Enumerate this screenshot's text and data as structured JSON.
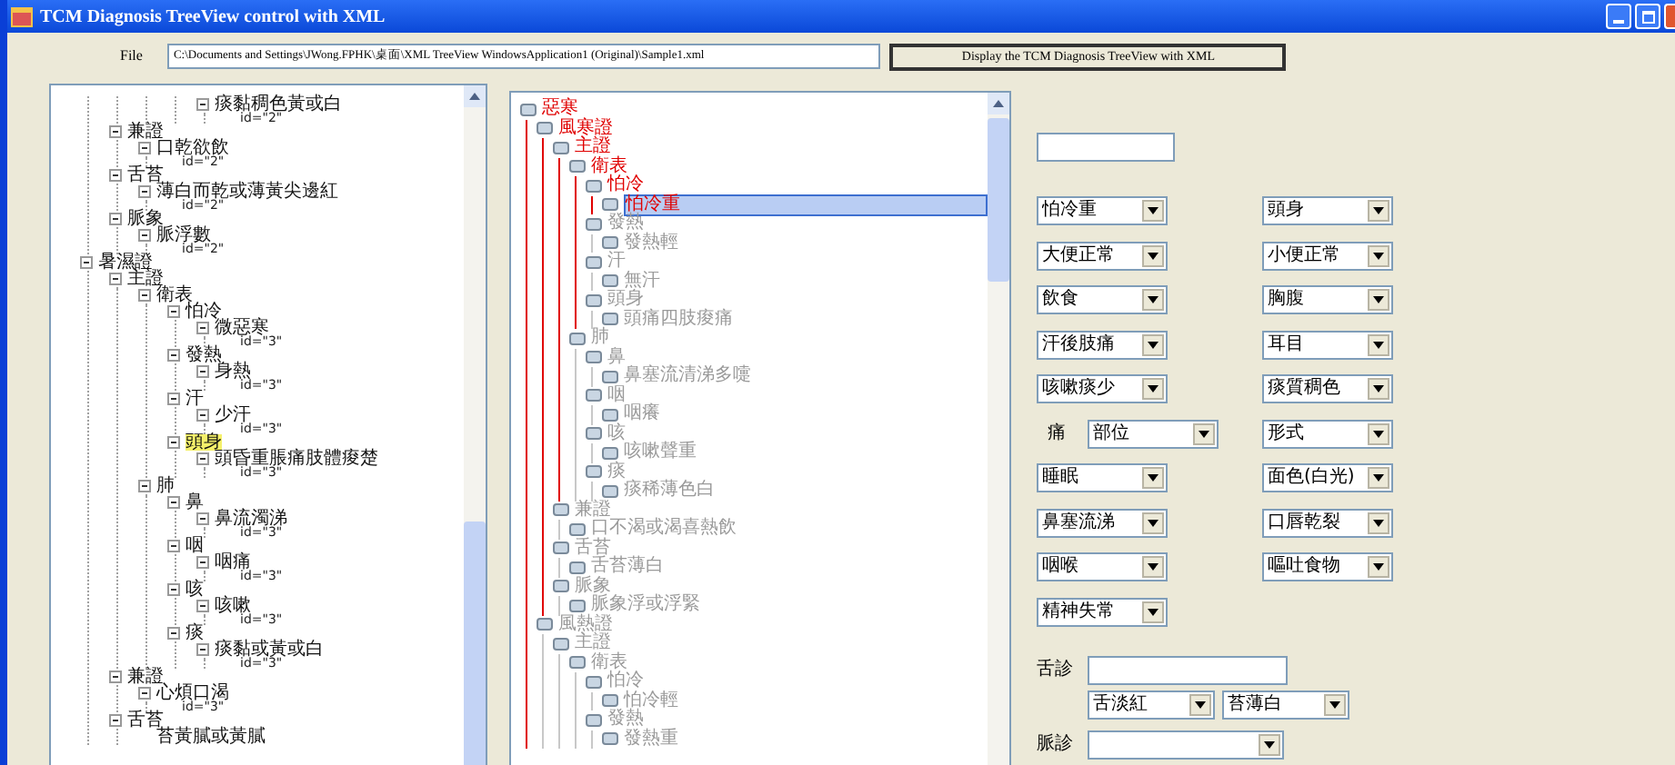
{
  "window": {
    "title": "TCM Diagnosis TreeView control with XML"
  },
  "file_row": {
    "label": "File",
    "path": "C:\\Documents and Settings\\JWong.FPHK\\桌面\\XML TreeView WindowsApplication1 (Original)\\Sample1.xml",
    "button": "Display the TCM Diagnosis TreeView with XML"
  },
  "xml_tree": {
    "nodes": [
      {
        "kind": "offscreen",
        "children": [
          {
            "kind": "offscreen",
            "children": [
              {
                "kind": "offscreen",
                "children": [
                  {
                    "kind": "offscreen",
                    "children": [
                      {
                        "kind": "node",
                        "label": "痰黏稠色黃或白",
                        "selected": false,
                        "children": [
                          {
                            "kind": "attr",
                            "label": "id=\"2\"",
                            "selected": false
                          }
                        ]
                      }
                    ]
                  }
                ]
              }
            ]
          },
          {
            "kind": "node",
            "label": "兼證",
            "selected": false,
            "children": [
              {
                "kind": "node",
                "label": "口乾欲飲",
                "selected": false,
                "children": [
                  {
                    "kind": "attr",
                    "label": "id=\"2\"",
                    "selected": false
                  }
                ]
              }
            ]
          },
          {
            "kind": "node",
            "label": "舌苔",
            "selected": false,
            "children": [
              {
                "kind": "node",
                "label": "薄白而乾或薄黃尖邊紅",
                "selected": false,
                "children": [
                  {
                    "kind": "attr",
                    "label": "id=\"2\"",
                    "selected": false
                  }
                ]
              }
            ]
          },
          {
            "kind": "node",
            "label": "脈象",
            "selected": false,
            "children": [
              {
                "kind": "node",
                "label": "脈浮數",
                "selected": false,
                "children": [
                  {
                    "kind": "attr",
                    "label": "id=\"2\"",
                    "selected": false
                  }
                ]
              }
            ]
          }
        ]
      },
      {
        "kind": "node",
        "label": "暑濕證",
        "selected": false,
        "children": [
          {
            "kind": "node",
            "label": "主證",
            "selected": false,
            "children": [
              {
                "kind": "node",
                "label": "衛表",
                "selected": false,
                "children": [
                  {
                    "kind": "node",
                    "label": "怕冷",
                    "selected": false,
                    "children": [
                      {
                        "kind": "node",
                        "label": "微惡寒",
                        "selected": false,
                        "children": [
                          {
                            "kind": "attr",
                            "label": "id=\"3\"",
                            "selected": false
                          }
                        ]
                      }
                    ]
                  },
                  {
                    "kind": "node",
                    "label": "發熱",
                    "selected": false,
                    "children": [
                      {
                        "kind": "node",
                        "label": "身熱",
                        "selected": false,
                        "children": [
                          {
                            "kind": "attr",
                            "label": "id=\"3\"",
                            "selected": false
                          }
                        ]
                      }
                    ]
                  },
                  {
                    "kind": "node",
                    "label": "汗",
                    "selected": false,
                    "children": [
                      {
                        "kind": "node",
                        "label": "少汗",
                        "selected": false,
                        "children": [
                          {
                            "kind": "attr",
                            "label": "id=\"3\"",
                            "selected": false
                          }
                        ]
                      }
                    ]
                  },
                  {
                    "kind": "node",
                    "label": "頭身",
                    "selected": true,
                    "children": [
                      {
                        "kind": "node",
                        "label": "頭昏重脹痛肢體痠楚",
                        "selected": false,
                        "children": [
                          {
                            "kind": "attr",
                            "label": "id=\"3\"",
                            "selected": false
                          }
                        ]
                      }
                    ]
                  }
                ]
              },
              {
                "kind": "node",
                "label": "肺",
                "selected": false,
                "children": [
                  {
                    "kind": "node",
                    "label": "鼻",
                    "selected": false,
                    "children": [
                      {
                        "kind": "node",
                        "label": "鼻流濁涕",
                        "selected": false,
                        "children": [
                          {
                            "kind": "attr",
                            "label": "id=\"3\"",
                            "selected": false
                          }
                        ]
                      }
                    ]
                  },
                  {
                    "kind": "node",
                    "label": "咽",
                    "selected": false,
                    "children": [
                      {
                        "kind": "node",
                        "label": "咽痛",
                        "selected": false,
                        "children": [
                          {
                            "kind": "attr",
                            "label": "id=\"3\"",
                            "selected": false
                          }
                        ]
                      }
                    ]
                  },
                  {
                    "kind": "node",
                    "label": "咳",
                    "selected": false,
                    "children": [
                      {
                        "kind": "node",
                        "label": "咳嗽",
                        "selected": false,
                        "children": [
                          {
                            "kind": "attr",
                            "label": "id=\"3\"",
                            "selected": false
                          }
                        ]
                      }
                    ]
                  },
                  {
                    "kind": "node",
                    "label": "痰",
                    "selected": false,
                    "children": [
                      {
                        "kind": "node",
                        "label": "痰黏或黃或白",
                        "selected": false,
                        "children": [
                          {
                            "kind": "attr",
                            "label": "id=\"3\"",
                            "selected": false
                          }
                        ]
                      }
                    ]
                  }
                ]
              }
            ]
          },
          {
            "kind": "node",
            "label": "兼證",
            "selected": false,
            "children": [
              {
                "kind": "node",
                "label": "心煩口渴",
                "selected": false,
                "children": [
                  {
                    "kind": "attr",
                    "label": "id=\"3\"",
                    "selected": false
                  }
                ]
              }
            ]
          },
          {
            "kind": "node",
            "label": "舌苔",
            "selected": false,
            "children": [
              {
                "kind": "node",
                "label": "苔黃膩或黃膩",
                "selected": false
              }
            ]
          }
        ]
      }
    ]
  },
  "diagnosis_tree": {
    "nodes": [
      {
        "label": "惡寒",
        "on_path": true,
        "selected": false,
        "children": [
          {
            "label": "風寒證",
            "on_path": true,
            "selected": false,
            "children": [
              {
                "label": "主證",
                "on_path": true,
                "selected": false,
                "children": [
                  {
                    "label": "衛表",
                    "on_path": true,
                    "selected": false,
                    "children": [
                      {
                        "label": "怕冷",
                        "on_path": true,
                        "selected": false,
                        "children": [
                          {
                            "label": "怕冷重",
                            "on_path": true,
                            "selected": true
                          }
                        ]
                      },
                      {
                        "label": "發熱",
                        "on_path": false,
                        "selected": false,
                        "children": [
                          {
                            "label": "發熱輕",
                            "on_path": false,
                            "selected": false
                          }
                        ]
                      },
                      {
                        "label": "汗",
                        "on_path": false,
                        "selected": false,
                        "children": [
                          {
                            "label": "無汗",
                            "on_path": false,
                            "selected": false
                          }
                        ]
                      },
                      {
                        "label": "頭身",
                        "on_path": false,
                        "selected": false,
                        "children": [
                          {
                            "label": "頭痛四肢痠痛",
                            "on_path": false,
                            "selected": false
                          }
                        ]
                      }
                    ]
                  },
                  {
                    "label": "肺",
                    "on_path": false,
                    "selected": false,
                    "children": [
                      {
                        "label": "鼻",
                        "on_path": false,
                        "selected": false,
                        "children": [
                          {
                            "label": "鼻塞流清涕多嚏",
                            "on_path": false,
                            "selected": false
                          }
                        ]
                      },
                      {
                        "label": "咽",
                        "on_path": false,
                        "selected": false,
                        "children": [
                          {
                            "label": "咽癢",
                            "on_path": false,
                            "selected": false
                          }
                        ]
                      },
                      {
                        "label": "咳",
                        "on_path": false,
                        "selected": false,
                        "children": [
                          {
                            "label": "咳嗽聲重",
                            "on_path": false,
                            "selected": false
                          }
                        ]
                      },
                      {
                        "label": "痰",
                        "on_path": false,
                        "selected": false,
                        "children": [
                          {
                            "label": "痰稀薄色白",
                            "on_path": false,
                            "selected": false
                          }
                        ]
                      }
                    ]
                  }
                ]
              },
              {
                "label": "兼證",
                "on_path": false,
                "selected": false,
                "children": [
                  {
                    "label": "口不渴或渴喜熱飲",
                    "on_path": false,
                    "selected": false
                  }
                ]
              },
              {
                "label": "舌苔",
                "on_path": false,
                "selected": false,
                "children": [
                  {
                    "label": "舌苔薄白",
                    "on_path": false,
                    "selected": false
                  }
                ]
              },
              {
                "label": "脈象",
                "on_path": false,
                "selected": false,
                "children": [
                  {
                    "label": "脈象浮或浮緊",
                    "on_path": false,
                    "selected": false
                  }
                ]
              }
            ]
          },
          {
            "label": "風熱證",
            "on_path": false,
            "selected": false,
            "children": [
              {
                "label": "主證",
                "on_path": false,
                "selected": false,
                "children": [
                  {
                    "label": "衛表",
                    "on_path": false,
                    "selected": false,
                    "children": [
                      {
                        "label": "怕冷",
                        "on_path": false,
                        "selected": false,
                        "children": [
                          {
                            "label": "怕冷輕",
                            "on_path": false,
                            "selected": false
                          }
                        ]
                      },
                      {
                        "label": "發熱",
                        "on_path": false,
                        "selected": false,
                        "children": [
                          {
                            "label": "發熱重",
                            "on_path": false,
                            "selected": false
                          }
                        ]
                      }
                    ]
                  }
                ]
              }
            ]
          }
        ]
      }
    ]
  },
  "selectors": [
    {
      "value": "怕冷重"
    },
    {
      "value": "頭身"
    },
    {
      "value": "大便正常"
    },
    {
      "value": "小便正常"
    },
    {
      "value": "飲食"
    },
    {
      "value": "胸腹"
    },
    {
      "value": "汗後肢痛"
    },
    {
      "value": "耳目"
    },
    {
      "value": "咳嗽痰少"
    },
    {
      "value": "痰質稠色"
    },
    {
      "label": "痛",
      "value": "部位"
    },
    {
      "value": "形式"
    },
    {
      "value": "睡眠"
    },
    {
      "value": "面色(白光)"
    },
    {
      "value": "鼻塞流涕"
    },
    {
      "value": "口唇乾裂"
    },
    {
      "value": "咽喉"
    },
    {
      "value": "嘔吐食物"
    },
    {
      "value": "精神失常"
    }
  ],
  "tongue": {
    "label": "舌診",
    "selectors": [
      "舌淡紅",
      "苔薄白"
    ]
  },
  "pulse": {
    "label": "脈診"
  }
}
